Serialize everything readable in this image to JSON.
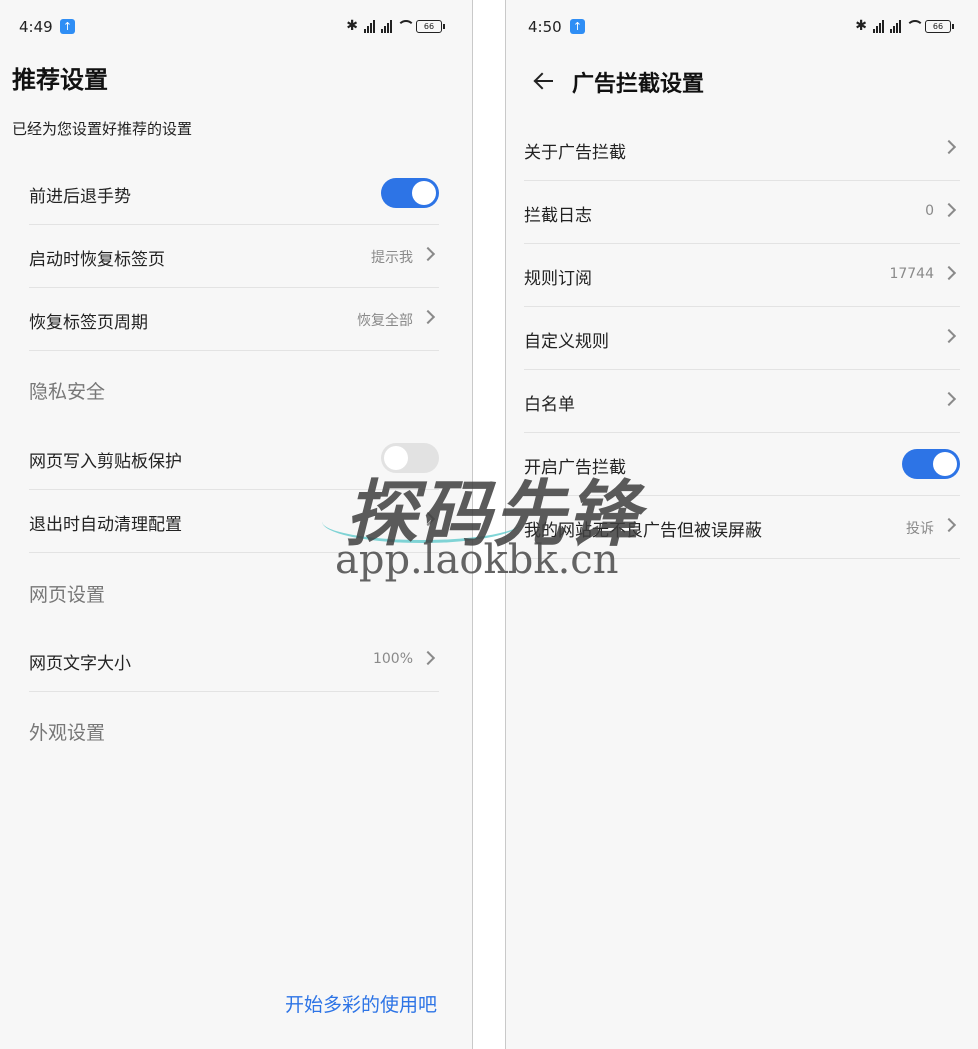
{
  "left": {
    "status": {
      "time": "4:49",
      "battery": "66"
    },
    "title": "推荐设置",
    "subtitle": "已经为您设置好推荐的设置",
    "rows": [
      {
        "label": "前进后退手势"
      },
      {
        "label": "启动时恢复标签页",
        "value": "提示我"
      },
      {
        "label": "恢复标签页周期",
        "value": "恢复全部"
      },
      {
        "label": "网页写入剪贴板保护"
      },
      {
        "label": "退出时自动清理配置"
      },
      {
        "label": "网页文字大小",
        "value": "100%"
      }
    ],
    "sections": [
      "隐私安全",
      "网页设置",
      "外观设置"
    ],
    "toggles": {
      "gesture": true,
      "clipboard": false
    },
    "footer": "开始多彩的使用吧"
  },
  "right": {
    "status": {
      "time": "4:50",
      "battery": "66"
    },
    "title": "广告拦截设置",
    "rows": [
      {
        "label": "关于广告拦截"
      },
      {
        "label": "拦截日志",
        "value": "0"
      },
      {
        "label": "规则订阅",
        "value": "17744"
      },
      {
        "label": "自定义规则"
      },
      {
        "label": "白名单"
      },
      {
        "label": "开启广告拦截"
      },
      {
        "label": "我的网站无不良广告但被误屏蔽",
        "value": "投诉"
      }
    ],
    "toggles": {
      "adblock": true
    }
  },
  "watermark": {
    "title": "探码先锋",
    "url": "app.laokbk.cn"
  },
  "colors": {
    "accent": "#2d74e6",
    "background": "#f7f7f7",
    "section": "#777777"
  }
}
